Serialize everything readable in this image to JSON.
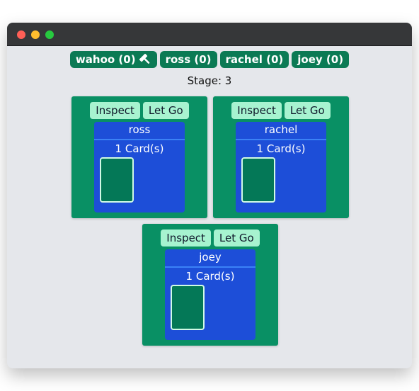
{
  "players": [
    {
      "label": "wahoo (0)",
      "has_hammer": true
    },
    {
      "label": "ross (0)",
      "has_hammer": false
    },
    {
      "label": "rachel (0)",
      "has_hammer": false
    },
    {
      "label": "joey (0)",
      "has_hammer": false
    }
  ],
  "stage": "Stage: 3",
  "hands": [
    {
      "name": "ross",
      "count": "1 Card(s)",
      "inspect": "Inspect",
      "let_go": "Let Go"
    },
    {
      "name": "rachel",
      "count": "1 Card(s)",
      "inspect": "Inspect",
      "let_go": "Let Go"
    },
    {
      "name": "joey",
      "count": "1 Card(s)",
      "inspect": "Inspect",
      "let_go": "Let Go"
    }
  ],
  "icons": {
    "host_marker": "hammer-icon"
  },
  "colors": {
    "pill": "#0b7a54",
    "panel": "#099064",
    "button": "#a7f3d0",
    "hand": "#1d4ed8",
    "card": "#047857"
  }
}
